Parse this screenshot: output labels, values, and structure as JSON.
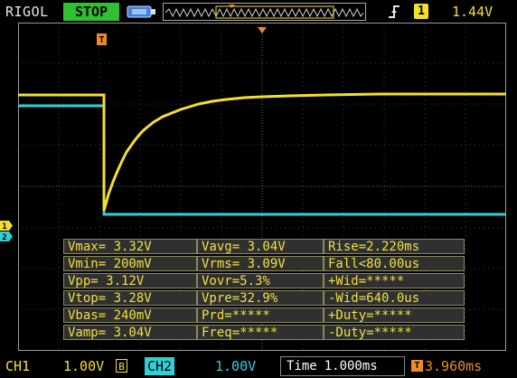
{
  "header": {
    "brand": "RIGOL",
    "run_status": "STOP",
    "trigger_type_icon": "rising-edge-icon",
    "trigger_source": "1",
    "trigger_level": "1.44V"
  },
  "measurements": {
    "rows": [
      [
        "Vmax= 3.32V",
        "Vavg= 3.04V",
        "Rise=2.220ms"
      ],
      [
        "Vmin= 200mV",
        "Vrms= 3.09V",
        "Fall<80.00us"
      ],
      [
        "Vpp= 3.12V",
        "Vovr=5.3%",
        "+Wid=*****"
      ],
      [
        "Vtop= 3.28V",
        "Vpre=32.9%",
        "-Wid=640.0us"
      ],
      [
        "Vbas= 240mV",
        "Prd=*****",
        "+Duty=*****"
      ],
      [
        "Vamp= 3.04V",
        "Freq=*****",
        "-Duty=*****"
      ]
    ]
  },
  "footer": {
    "ch1_label": "CH1",
    "ch1_scale": "1.00V",
    "ch1_bw_icon": "B",
    "ch2_label": "CH2",
    "ch2_scale": "1.00V",
    "time_label": "Time",
    "time_value": "1.000ms",
    "trigger_offset_icon": "T",
    "trigger_offset": "3.960ms"
  },
  "markers": {
    "trigger_marker": "T",
    "ch1_marker": "1",
    "ch2_marker": "2"
  },
  "colors": {
    "ch1": "#f4e02a",
    "ch2": "#2fd0d8",
    "trigger": "#f08a24",
    "grid": "#4a4a4a",
    "run_status_bg": "#2fc12f"
  }
}
